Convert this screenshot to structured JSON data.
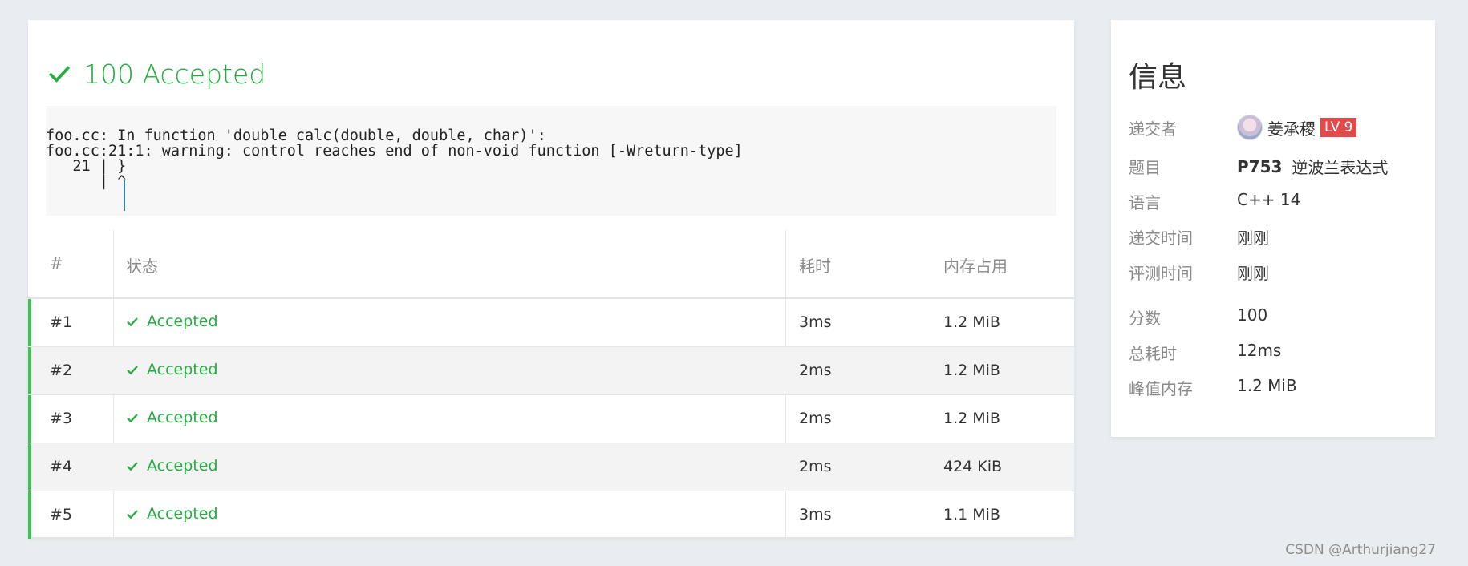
{
  "result": {
    "score": "100",
    "status": "Accepted"
  },
  "compiler_output": "foo.cc: In function 'double calc(double, double, char)':\nfoo.cc:21:1: warning: control reaches end of non-void function [-Wreturn-type]\n   21 | }\n      | ^",
  "table": {
    "headers": {
      "num": "#",
      "status": "状态",
      "time": "耗时",
      "memory": "内存占用"
    },
    "rows": [
      {
        "num": "#1",
        "status": "Accepted",
        "time": "3ms",
        "memory": "1.2 MiB"
      },
      {
        "num": "#2",
        "status": "Accepted",
        "time": "2ms",
        "memory": "1.2 MiB"
      },
      {
        "num": "#3",
        "status": "Accepted",
        "time": "2ms",
        "memory": "1.2 MiB"
      },
      {
        "num": "#4",
        "status": "Accepted",
        "time": "2ms",
        "memory": "424 KiB"
      },
      {
        "num": "#5",
        "status": "Accepted",
        "time": "3ms",
        "memory": "1.1 MiB"
      }
    ]
  },
  "info": {
    "title": "信息",
    "submitter_label": "递交者",
    "submitter_name": "姜承稷",
    "submitter_level": "LV 9",
    "problem_label": "题目",
    "problem_id": "P753",
    "problem_name": "逆波兰表达式",
    "language_label": "语言",
    "language": "C++ 14",
    "submit_time_label": "递交时间",
    "submit_time": "刚刚",
    "judge_time_label": "评测时间",
    "judge_time": "刚刚",
    "score_label": "分数",
    "score": "100",
    "total_time_label": "总耗时",
    "total_time": "12ms",
    "peak_memory_label": "峰值内存",
    "peak_memory": "1.2 MiB"
  },
  "watermark": "CSDN @Arthurjiang27",
  "colors": {
    "accepted": "#25ad40",
    "link": "#3a8fd6",
    "level_badge": "#e04a4a"
  }
}
